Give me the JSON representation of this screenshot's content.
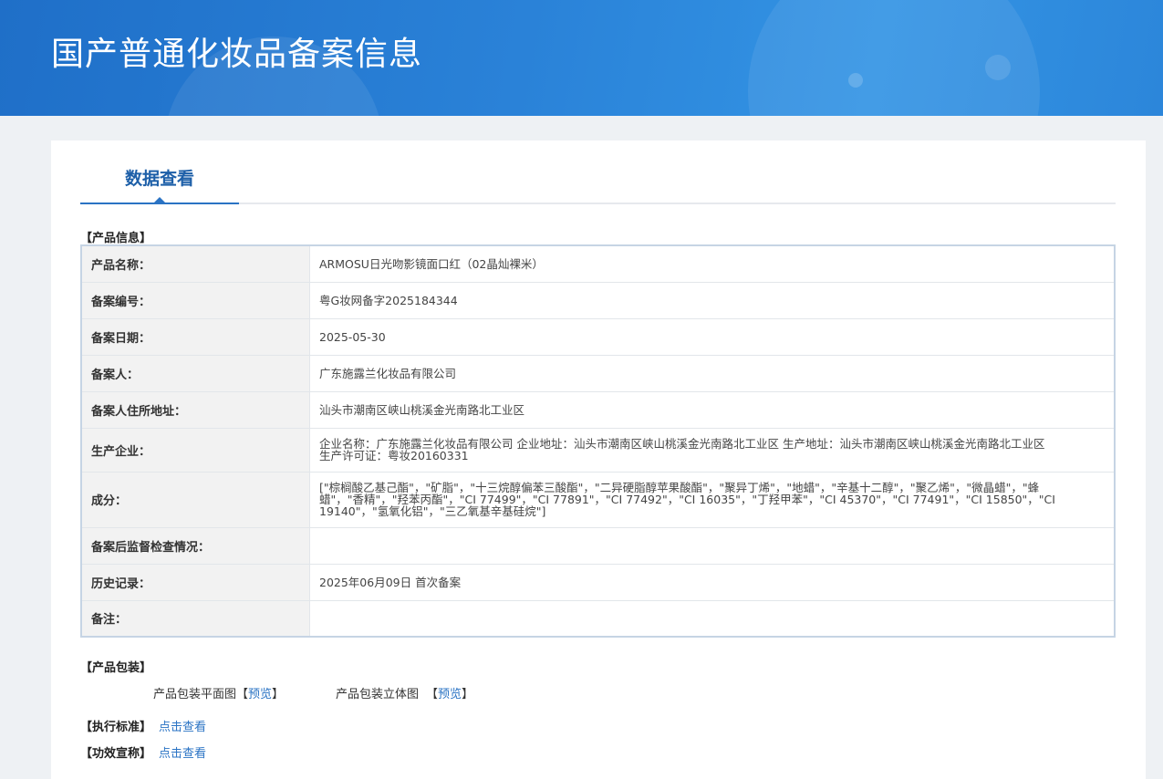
{
  "banner": {
    "title": "国产普通化妆品备案信息"
  },
  "tabs": [
    {
      "label": "数据查看"
    }
  ],
  "sections": {
    "product_info": "【产品信息】",
    "packaging": "【产品包装】",
    "standard": "【执行标准】",
    "efficacy": "【功效宣称】"
  },
  "product_info": {
    "rows": [
      {
        "label": "产品名称：",
        "value": "ARMOSU日光吻影镜面口红（02晶灿裸米）"
      },
      {
        "label": "备案编号：",
        "value": "粤G妆网备字2025184344"
      },
      {
        "label": "备案日期：",
        "value": "2025-05-30"
      },
      {
        "label": "备案人：",
        "value": "广东施露兰化妆品有限公司"
      },
      {
        "label": "备案人住所地址：",
        "value": "汕头市潮南区峡山桃溪金光南路北工业区"
      },
      {
        "label": "生产企业：",
        "value": "企业名称：广东施露兰化妆品有限公司 企业地址：汕头市潮南区峡山桃溪金光南路北工业区 生产地址：汕头市潮南区峡山桃溪金光南路北工业区 生产许可证：粤妆20160331"
      },
      {
        "label": "成分：",
        "value": "[\"棕榈酸乙基己酯\"，\"矿脂\"，\"十三烷醇偏苯三酸酯\"，\"二异硬脂醇苹果酸酯\"，\"聚异丁烯\"，\"地蜡\"，\"辛基十二醇\"，\"聚乙烯\"，\"微晶蜡\"，\"蜂蜡\"，\"香精\"，\"羟苯丙酯\"，\"CI 77499\"，\"CI 77891\"，\"CI 77492\"，\"CI 16035\"，\"丁羟甲苯\"，\"CI 45370\"，\"CI 77491\"，\"CI 15850\"，\"CI 19140\"，\"氢氧化铝\"，\"三乙氧基辛基硅烷\"]"
      },
      {
        "label": "备案后监督检查情况：",
        "value": ""
      },
      {
        "label": "历史记录：",
        "value": "2025年06月09日 首次备案"
      },
      {
        "label": "备注：",
        "value": ""
      }
    ]
  },
  "packaging": {
    "flat_label": "产品包装平面图",
    "flat_link": "预览",
    "solid_label": "产品包装立体图",
    "solid_link": "预览",
    "bracket_open": "【",
    "bracket_close": "】"
  },
  "standard": {
    "link": "点击查看"
  },
  "efficacy": {
    "link": "点击查看"
  },
  "colors": {
    "banner": "#2a82d8",
    "accent": "#2a73c4",
    "tab_text": "#1d5fa8"
  }
}
